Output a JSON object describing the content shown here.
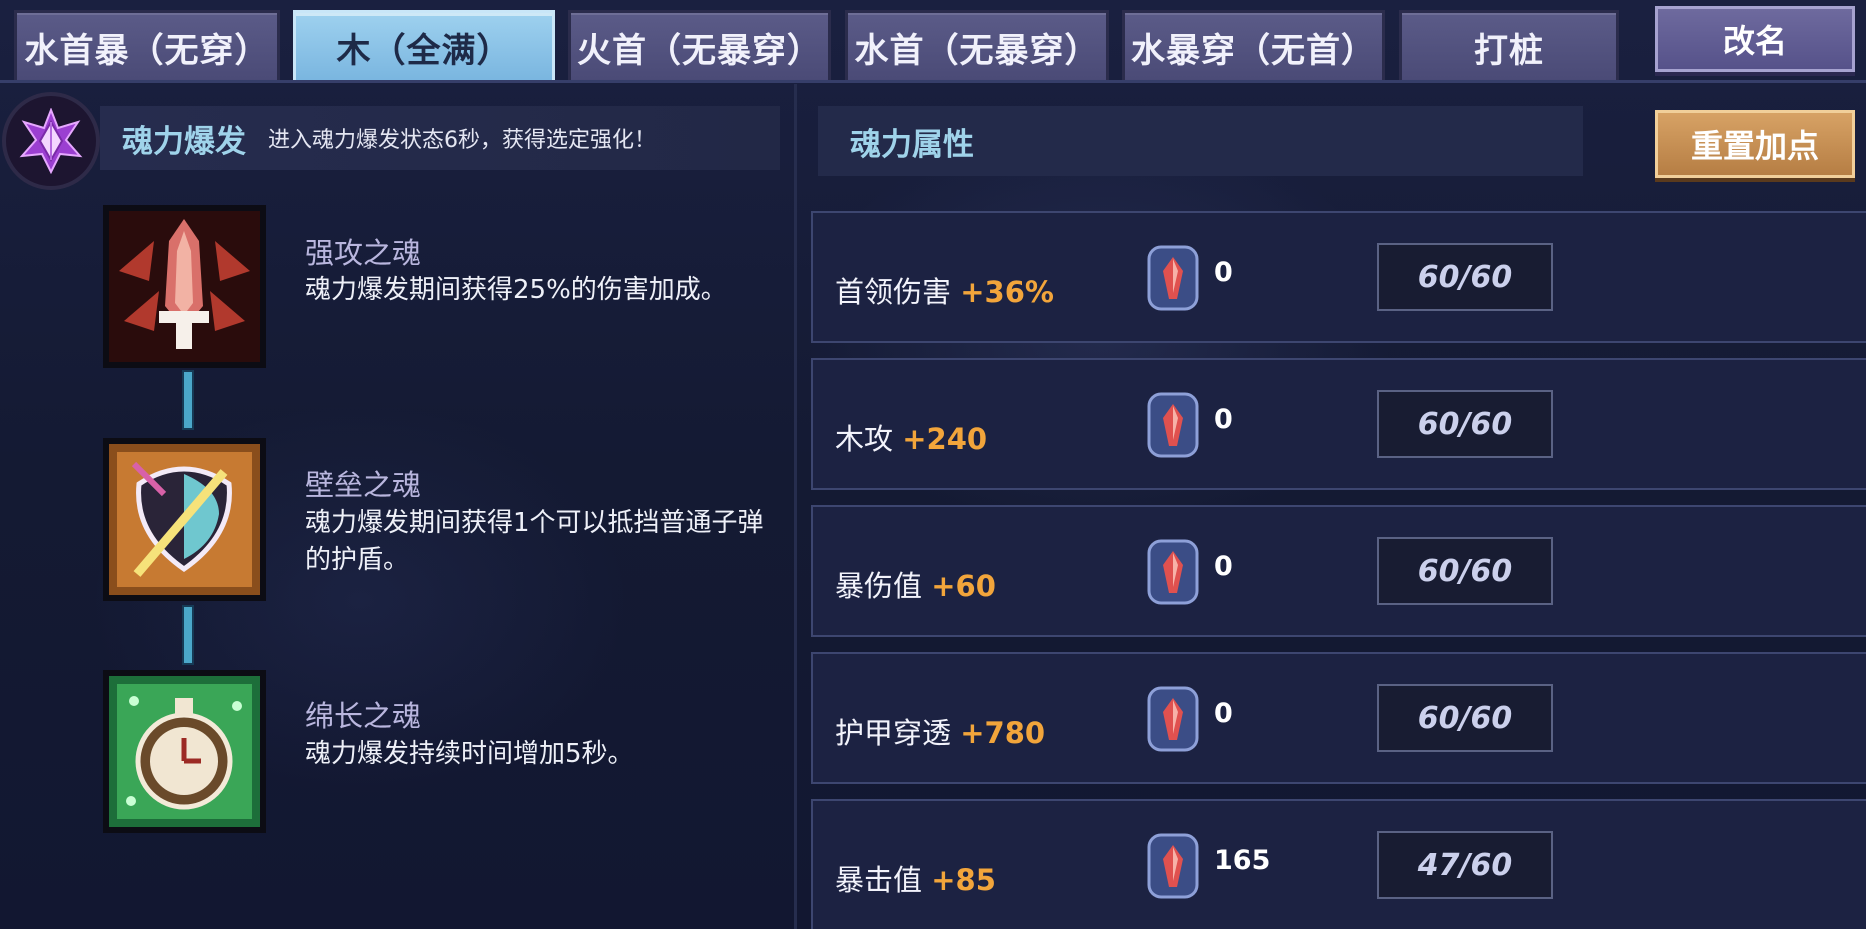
{
  "tabs": [
    {
      "label": "水首暴（无穿）",
      "active": false
    },
    {
      "label": "木（全满）",
      "active": true
    },
    {
      "label": "火首（无暴穿）",
      "active": false
    },
    {
      "label": "水首（无暴穿）",
      "active": false
    },
    {
      "label": "水暴穿（无首）",
      "active": false
    },
    {
      "label": "打桩",
      "active": false
    }
  ],
  "rename_label": "改名",
  "soul_burst": {
    "title": "魂力爆发",
    "description": "进入魂力爆发状态6秒，获得选定强化！"
  },
  "skills": [
    {
      "title": "强攻之魂",
      "description": "魂力爆发期间获得25%的伤害加成。",
      "icon": "red-flame-sword-icon"
    },
    {
      "title": "壁垒之魂",
      "description": "魂力爆发期间获得1个可以抵挡普通子弹的护盾。",
      "icon": "shield-sword-icon"
    },
    {
      "title": "绵长之魂",
      "description": "魂力爆发持续时间增加5秒。",
      "icon": "stopwatch-icon"
    }
  ],
  "attributes_panel": {
    "title": "魂力属性",
    "reset_label": "重置加点"
  },
  "attributes": [
    {
      "name": "首领伤害",
      "bonus": "+36%",
      "points": "0",
      "level": "60/60"
    },
    {
      "name": "木攻",
      "bonus": "+240",
      "points": "0",
      "level": "60/60"
    },
    {
      "name": "暴伤值",
      "bonus": "+60",
      "points": "0",
      "level": "60/60"
    },
    {
      "name": "护甲穿透",
      "bonus": "+780",
      "points": "0",
      "level": "60/60"
    },
    {
      "name": "暴击值",
      "bonus": "+85",
      "points": "165",
      "level": "47/60"
    }
  ],
  "colors": {
    "background": "#151a30",
    "tab_active": "#8fc6ea",
    "tab_inactive": "#52527e",
    "accent_cyan": "#9fd3ea",
    "bonus_orange": "#f2a53b",
    "reset_button": "#c48e54"
  }
}
